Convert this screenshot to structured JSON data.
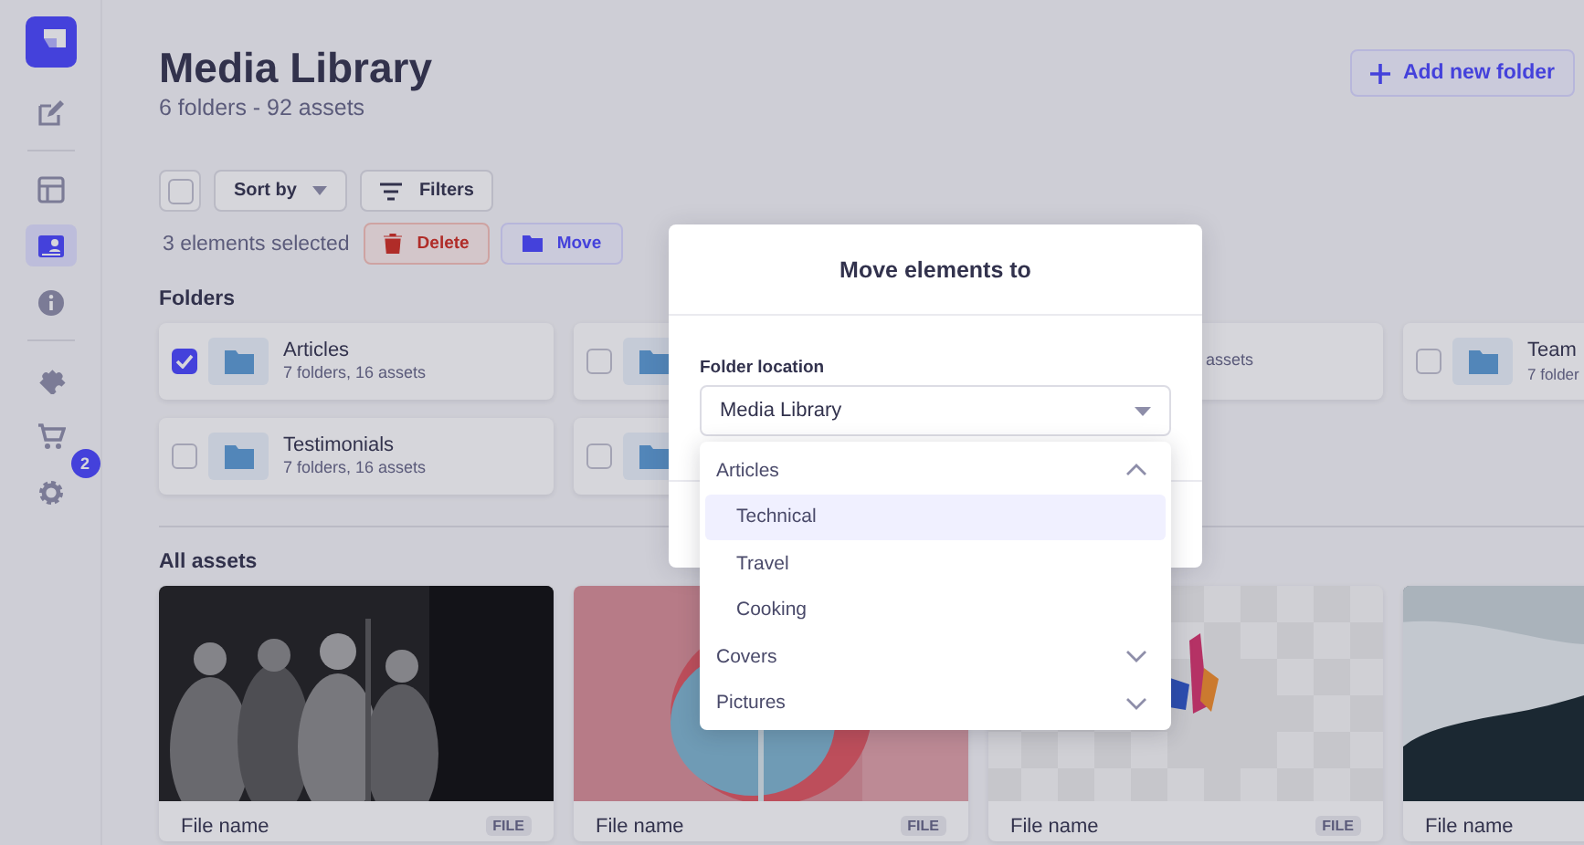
{
  "sidebar": {
    "items": [
      {
        "selected": false
      },
      {
        "selected": false
      },
      {
        "selected": true
      },
      {
        "selected": false
      },
      {
        "selected": false
      },
      {
        "selected": false
      },
      {
        "selected": false,
        "badge": "2"
      }
    ]
  },
  "header": {
    "title": "Media Library",
    "subtitle": "6 folders - 92 assets",
    "add_button": "Add new folder"
  },
  "toolbar": {
    "select_all": {
      "checked": false
    },
    "sort_label": "Sort by",
    "filters_label": "Filters",
    "selection_text": "3 elements selected",
    "delete_label": "Delete",
    "move_label": "Move"
  },
  "folders": {
    "heading": "Folders",
    "items": [
      {
        "title": "Articles",
        "subtitle": "7 folders, 16 assets",
        "checked": true
      },
      {
        "checked": false
      },
      {
        "subtitle": "assets"
      },
      {
        "title": "Team",
        "subtitle": "7 folder",
        "checked": false
      },
      {
        "title": "Testimonials",
        "subtitle": "7 folders, 16 assets",
        "checked": false
      },
      {
        "checked": false
      }
    ]
  },
  "assets": {
    "heading": "All assets",
    "items": [
      {
        "name": "File name",
        "tag": "FILE"
      },
      {
        "name": "File name",
        "tag": "FILE"
      },
      {
        "name": "File name",
        "tag": "FILE"
      },
      {
        "name": "File name"
      }
    ]
  },
  "modal": {
    "title": "Move elements to",
    "field_label": "Folder location",
    "select_value": "Media Library",
    "options": [
      {
        "label": "Articles",
        "expanded": true,
        "children": [
          {
            "label": "Technical",
            "selected": true
          },
          {
            "label": "Travel",
            "selected": false
          },
          {
            "label": "Cooking",
            "selected": false
          }
        ]
      },
      {
        "label": "Covers",
        "expanded": false
      },
      {
        "label": "Pictures",
        "expanded": false
      }
    ]
  }
}
